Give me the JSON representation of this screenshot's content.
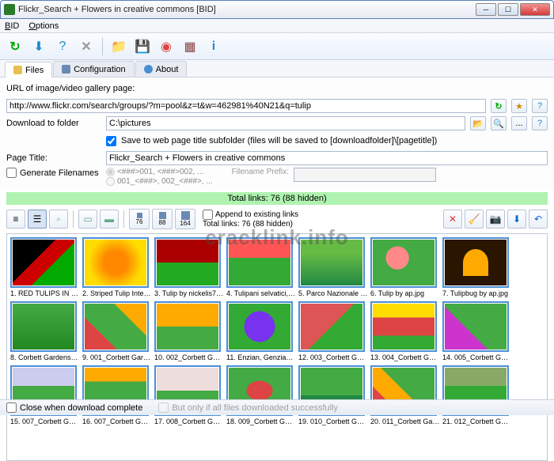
{
  "window": {
    "title": "Flickr_Search + Flowers in creative commons [BID]"
  },
  "menu": {
    "bid": "BID",
    "options": "Options"
  },
  "tabs": {
    "files": "Files",
    "configuration": "Configuration",
    "about": "About"
  },
  "form": {
    "url_label": "URL of image/video gallery page:",
    "url_value": "http://www.flickr.com/search/groups/?m=pool&z=t&w=462981%40N21&q=tulip",
    "download_label": "Download to folder",
    "download_value": "C:\\pictures",
    "save_subfolder": "Save to web page title subfolder (files will be saved to [downloadfolder]\\[pagetitle])",
    "pagetitle_label": "Page Title:",
    "pagetitle_value": "Flickr_Search + Flowers in creative commons",
    "gen_filenames": "Generate Filenames",
    "radio1": "<###>001, <###>002, ...",
    "radio2": "001_<###>, 002_<###>, ...",
    "prefix_label": "Filename Prefix:"
  },
  "status": {
    "total_links": "Total links: 76 (88 hidden)"
  },
  "toolbar2": {
    "append": "Append to existing links",
    "total": "Total links: 76 (88 hidden)",
    "s76": "76",
    "s88": "88",
    "s164": "164"
  },
  "thumbs": [
    {
      "cap": "1. RED TULIPS IN RED...",
      "cls": "t1"
    },
    {
      "cap": "2. Striped Tulip Interio...",
      "cls": "t2"
    },
    {
      "cap": "3. Tulip by nickelis74.jpg",
      "cls": "t3"
    },
    {
      "cap": "4. Tulipani selvatici, Wi...",
      "cls": "t4"
    },
    {
      "cap": "5. Parco Nazionale dei...",
      "cls": "t5"
    },
    {
      "cap": "6. Tulip by ap.jpg",
      "cls": "t6"
    },
    {
      "cap": "7. Tulipbug by ap.jpg",
      "cls": "t7"
    },
    {
      "cap": "8. Corbett Gardens Bo...",
      "cls": "t8"
    },
    {
      "cap": "9. 001_Corbett Gard...",
      "cls": "t9"
    },
    {
      "cap": "10. 002_Corbett Gard...",
      "cls": "t10"
    },
    {
      "cap": "11. Enzian, Genzianell...",
      "cls": "t11"
    },
    {
      "cap": "12. 003_Corbett Gard...",
      "cls": "t12"
    },
    {
      "cap": "13. 004_Corbett Gard...",
      "cls": "t13"
    },
    {
      "cap": "14. 005_Corbett Gard...",
      "cls": "t14"
    },
    {
      "cap": "15. 007_Corbett Gard...",
      "cls": "t15"
    },
    {
      "cap": "16. 007_Corbett Gard...",
      "cls": "t16"
    },
    {
      "cap": "17. 008_Corbett Gard...",
      "cls": "t17"
    },
    {
      "cap": "18. 009_Corbett Gard...",
      "cls": "t18"
    },
    {
      "cap": "19. 010_Corbett Gard...",
      "cls": "t19"
    },
    {
      "cap": "20. 011_Corbett Gard...",
      "cls": "t20"
    },
    {
      "cap": "21. 012_Corbett Gard...",
      "cls": "t21"
    }
  ],
  "footer": {
    "close_when": "Close when download complete",
    "only_if": "But only if all files downloaded successfully"
  },
  "watermark": "cracklink.info"
}
